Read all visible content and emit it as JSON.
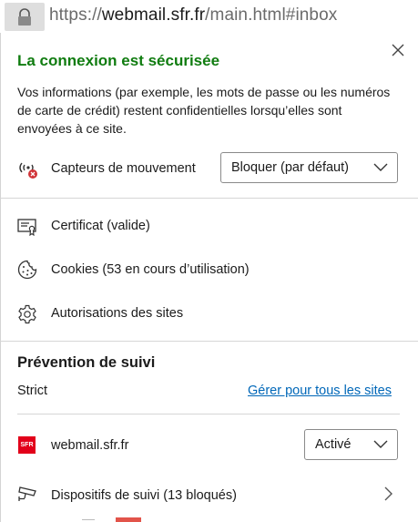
{
  "address_bar": {
    "url_scheme": "https://",
    "url_domain": "webmail.sfr.fr",
    "url_path": "/main.html#inbox",
    "icon": "lock-icon"
  },
  "panel": {
    "title": "La connexion est sécurisée",
    "description": "Vos informations (par exemple, les mots de passe ou les numéros de carte de crédit) restent confidentielles lorsqu’elles sont envoyées à ce site.",
    "close_icon": "close-icon",
    "title_color": "#107c10"
  },
  "motion_sensors": {
    "label": "Capteurs de mouvement",
    "icon": "motion-sensor-blocked-icon",
    "select_value": "Bloquer (par défaut)"
  },
  "info_items": [
    {
      "label": "Certificat (valide)",
      "icon": "certificate-icon"
    },
    {
      "label": "Cookies (53 en cours d’utilisation)",
      "icon": "cookie-icon"
    },
    {
      "label": "Autorisations des sites",
      "icon": "gear-icon"
    }
  ],
  "tracking": {
    "title": "Prévention de suivi",
    "level": "Strict",
    "manage_link": "Gérer pour tous les sites",
    "link_color": "#0067b8",
    "site_name": "webmail.sfr.fr",
    "site_logo_text": "SFR",
    "site_toggle_value": "Activé",
    "trackers_label": "Dispositifs de suivi (13 bloqués)",
    "trackers_icon": "tracker-camera-icon"
  }
}
